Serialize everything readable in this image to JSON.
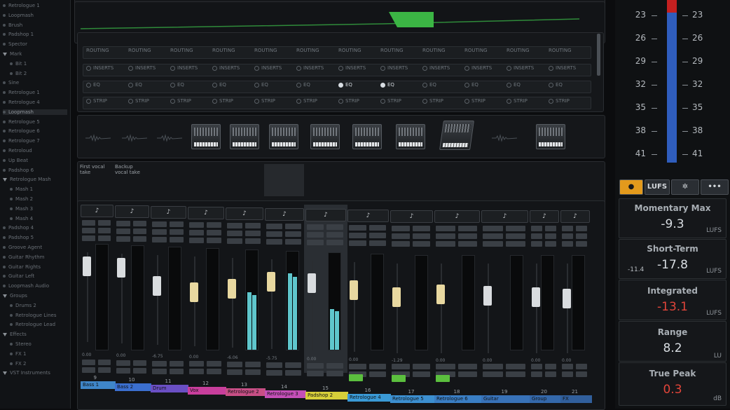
{
  "tree": {
    "items": [
      {
        "label": "Retrologue 1",
        "type": "dot"
      },
      {
        "label": "Loopmash",
        "type": "dot"
      },
      {
        "label": "Brush",
        "type": "dot"
      },
      {
        "label": "Padshop 1",
        "type": "dot"
      },
      {
        "label": "Spector",
        "type": "dot"
      },
      {
        "label": "Mark",
        "type": "tri"
      },
      {
        "label": "Bit 1",
        "type": "dot"
      },
      {
        "label": "Bit 2",
        "type": "dot"
      },
      {
        "label": "Sine",
        "type": "dot"
      },
      {
        "label": "Retrologue 1",
        "type": "dot"
      },
      {
        "label": "Retrologue 4",
        "type": "dot"
      },
      {
        "label": "Loopmash",
        "type": "dot",
        "selected": true
      },
      {
        "label": "Retrologue 5",
        "type": "dot"
      },
      {
        "label": "Retrologue 6",
        "type": "dot"
      },
      {
        "label": "Retrologue 7",
        "type": "dot"
      },
      {
        "label": "Retroloud",
        "type": "dot"
      },
      {
        "label": "Up Beat",
        "type": "dot"
      },
      {
        "label": "Padshop 6",
        "type": "dot"
      },
      {
        "label": "Retrologue Mash",
        "type": "tri"
      },
      {
        "label": "Mash 1",
        "type": "dot"
      },
      {
        "label": "Mash 2",
        "type": "dot"
      },
      {
        "label": "Mash 3",
        "type": "dot"
      },
      {
        "label": "Mash 4",
        "type": "dot"
      },
      {
        "label": "Padshop 4",
        "type": "dot"
      },
      {
        "label": "Padshop 5",
        "type": "dot"
      },
      {
        "label": "Groove Agent",
        "type": "dot"
      },
      {
        "label": "Guitar Rhythm",
        "type": "dot"
      },
      {
        "label": "Guitar Rights",
        "type": "dot"
      },
      {
        "label": "Guitar Left",
        "type": "dot"
      },
      {
        "label": "Loopmash Audio",
        "type": "dot"
      },
      {
        "label": "Groups",
        "type": "tri"
      },
      {
        "label": "Drums 2",
        "type": "dot"
      },
      {
        "label": "Retrologue Lines",
        "type": "dot"
      },
      {
        "label": "Retrologue Lead",
        "type": "dot"
      },
      {
        "label": "Effects",
        "type": "tri"
      },
      {
        "label": "Stereo",
        "type": "dot"
      },
      {
        "label": "FX 1",
        "type": "dot"
      },
      {
        "label": "FX 2",
        "type": "dot"
      },
      {
        "label": "VST Instruments",
        "type": "tri"
      }
    ]
  },
  "rack": {
    "routing_label": "ROUTING",
    "inserts_label": "INSERTS",
    "eq_label": "EQ",
    "strip_label": "STRIP",
    "count": 12,
    "eq_active": [
      6,
      7
    ]
  },
  "notepad": {
    "items": [
      {
        "label": "First vocal take"
      },
      {
        "label": "Backup vocal take"
      }
    ]
  },
  "mixer": {
    "channels": [
      {
        "num": "9",
        "name": "Bass 1",
        "color": "#3f86c9",
        "fader": "#d9dcdf",
        "meter": 0,
        "sel": false,
        "green": false,
        "val": "0.00"
      },
      {
        "num": "10",
        "name": "Bass 2",
        "color": "#3b6fcf",
        "fader": "#d9dcdf",
        "meter": 0,
        "sel": false,
        "green": false,
        "val": "0.00"
      },
      {
        "num": "11",
        "name": "Drum",
        "color": "#6a4fc4",
        "fader": "#d9dcdf",
        "meter": 0,
        "sel": false,
        "green": false,
        "val": "-6.75"
      },
      {
        "num": "12",
        "name": "Vox",
        "color": "#c83e9c",
        "fader": "#e8d8a0",
        "meter": 0,
        "sel": false,
        "green": false,
        "val": "0.00"
      },
      {
        "num": "13",
        "name": "Retrologue 2",
        "color": "#c84f86",
        "fader": "#e8d8a0",
        "meter": 0.58,
        "sel": false,
        "green": false,
        "val": "-6.06"
      },
      {
        "num": "14",
        "name": "Retrologue 3",
        "color": "#c44fb8",
        "fader": "#e8d8a0",
        "meter": 0.78,
        "sel": false,
        "green": false,
        "val": "-5.75"
      },
      {
        "num": "15",
        "name": "Padshop 2",
        "color": "#d7cf3a",
        "fader": "#d9dcdf",
        "meter": 0.42,
        "sel": true,
        "green": false,
        "val": "0.00"
      },
      {
        "num": "16",
        "name": "Retrologue 4",
        "color": "#3a9ad6",
        "fader": "#e8d8a0",
        "meter": 0,
        "sel": false,
        "green": true,
        "val": "0.00"
      },
      {
        "num": "17",
        "name": "Retrologue 5",
        "color": "#3c8fd0",
        "fader": "#e8d8a0",
        "meter": 0,
        "sel": false,
        "green": true,
        "val": "-1.29"
      },
      {
        "num": "18",
        "name": "Retrologue 6",
        "color": "#3a7ec4",
        "fader": "#e8d8a0",
        "meter": 0,
        "sel": false,
        "green": true,
        "val": "0.00"
      },
      {
        "num": "19",
        "name": "Guitar",
        "color": "#3872b8",
        "fader": "#d9dcdf",
        "meter": 0,
        "sel": false,
        "green": false,
        "val": "0.00"
      },
      {
        "num": "20",
        "name": "Group",
        "color": "#3468aa",
        "fader": "#d9dcdf",
        "meter": 0,
        "sel": false,
        "green": false,
        "val": "0.00"
      },
      {
        "num": "21",
        "name": "FX",
        "color": "#315f9c",
        "fader": "#d9dcdf",
        "meter": 0,
        "sel": false,
        "green": false,
        "val": "0.00"
      }
    ]
  },
  "loudness": {
    "scale": [
      "23",
      "26",
      "29",
      "32",
      "35",
      "38",
      "41"
    ],
    "toolbar": {
      "power": "●",
      "lufs": "LUFS",
      "gear": "✲",
      "more": "•••"
    },
    "momentary_max": {
      "label": "Momentary Max",
      "value": "-9.3",
      "unit": "LUFS"
    },
    "short_term": {
      "label": "Short-Term",
      "value": "-17.8",
      "side": "-11.4",
      "unit": "LUFS"
    },
    "integrated": {
      "label": "Integrated",
      "value": "-13.1",
      "unit": "LUFS"
    },
    "range": {
      "label": "Range",
      "value": "8.2",
      "unit": "LU"
    },
    "true_peak": {
      "label": "True Peak",
      "value": "0.3",
      "unit": "dB"
    }
  },
  "colors": {
    "accent_green": "#4fbf3a",
    "meter_cyan": "#5fc6cc",
    "red_value": "#e2453a",
    "power_orange": "#e39a1c",
    "meter_blue": "#2f5dbd",
    "meter_red": "#c42020"
  }
}
